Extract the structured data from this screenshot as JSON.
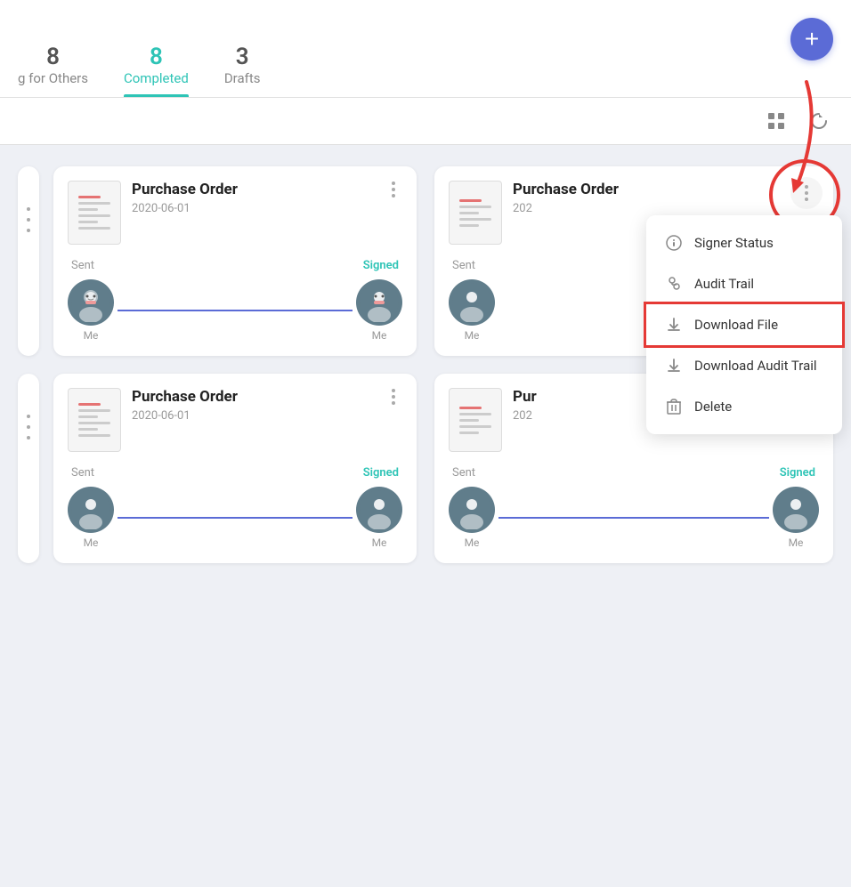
{
  "header": {
    "tabs": [
      {
        "id": "waiting",
        "count": "8",
        "label": "g for Others",
        "active": false
      },
      {
        "id": "completed",
        "count": "8",
        "label": "Completed",
        "active": true
      },
      {
        "id": "drafts",
        "count": "3",
        "label": "Drafts",
        "active": false
      }
    ],
    "add_button_label": "+"
  },
  "toolbar": {
    "grid_icon": "⊞",
    "refresh_icon": "↺"
  },
  "cards": [
    {
      "id": "card1",
      "title": "Purchase Order",
      "date": "2020-06-01",
      "sent_label": "Sent",
      "status": "Signed",
      "signer1_label": "Me",
      "signer2_label": "Me"
    },
    {
      "id": "card2",
      "title": "Purchase Order",
      "date": "202",
      "sent_label": "Sent",
      "status": "",
      "signer1_label": "Me",
      "signer2_label": ""
    },
    {
      "id": "card3",
      "title": "Purchase Order",
      "date": "2020-06-01",
      "sent_label": "Sent",
      "status": "Signed",
      "signer1_label": "Me",
      "signer2_label": "Me"
    },
    {
      "id": "card4",
      "title": "Pur",
      "date": "202",
      "sent_label": "Sent",
      "status": "Signed",
      "signer1_label": "Me",
      "signer2_label": "Me"
    }
  ],
  "dropdown": {
    "items": [
      {
        "id": "signer-status",
        "icon": "ℹ",
        "label": "Signer Status"
      },
      {
        "id": "audit-trail",
        "icon": "👤",
        "label": "Audit Trail"
      },
      {
        "id": "download-file",
        "icon": "↓",
        "label": "Download File",
        "highlighted": true
      },
      {
        "id": "download-audit-trail",
        "icon": "↓",
        "label": "Download Audit Trail"
      },
      {
        "id": "delete",
        "icon": "🗑",
        "label": "Delete"
      }
    ]
  },
  "colors": {
    "accent": "#2ec4b6",
    "brand_blue": "#5b6bd6",
    "danger": "#e53935"
  }
}
